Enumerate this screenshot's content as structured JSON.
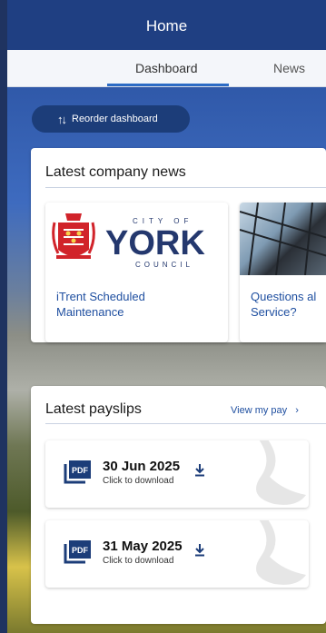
{
  "header": {
    "title": "Home"
  },
  "tabs": [
    {
      "label": "Dashboard",
      "active": true
    },
    {
      "label": "News",
      "active": false
    }
  ],
  "reorder_button": {
    "label": "Reorder dashboard",
    "icon": "reorder-arrows-icon"
  },
  "news_section": {
    "title": "Latest company news",
    "items": [
      {
        "title": "iTrent Scheduled Maintenance",
        "title_line1": "iTrent Scheduled",
        "title_line2": "Maintenance",
        "image": "city-of-york-council-logo",
        "logo_top": "CITY OF",
        "logo_main": "YORK",
        "logo_bottom": "COUNCIL"
      },
      {
        "title": "Questions al Service?",
        "title_line1": "Questions al",
        "title_line2": "Service?",
        "image": "glass-roof-photo"
      }
    ]
  },
  "payslips_section": {
    "title": "Latest payslips",
    "view_link": "View my pay",
    "view_link_chevron": "›",
    "items": [
      {
        "date": "30 Jun 2025",
        "action": "Click to download",
        "icon": "pdf-icon"
      },
      {
        "date": "31 May 2025",
        "action": "Click to download",
        "icon": "pdf-icon"
      }
    ]
  },
  "colors": {
    "header_bg": "#1f3f82",
    "accent": "#2c6bc4",
    "link": "#1f4fa0",
    "york_red": "#d1232a",
    "york_navy": "#24386e"
  }
}
